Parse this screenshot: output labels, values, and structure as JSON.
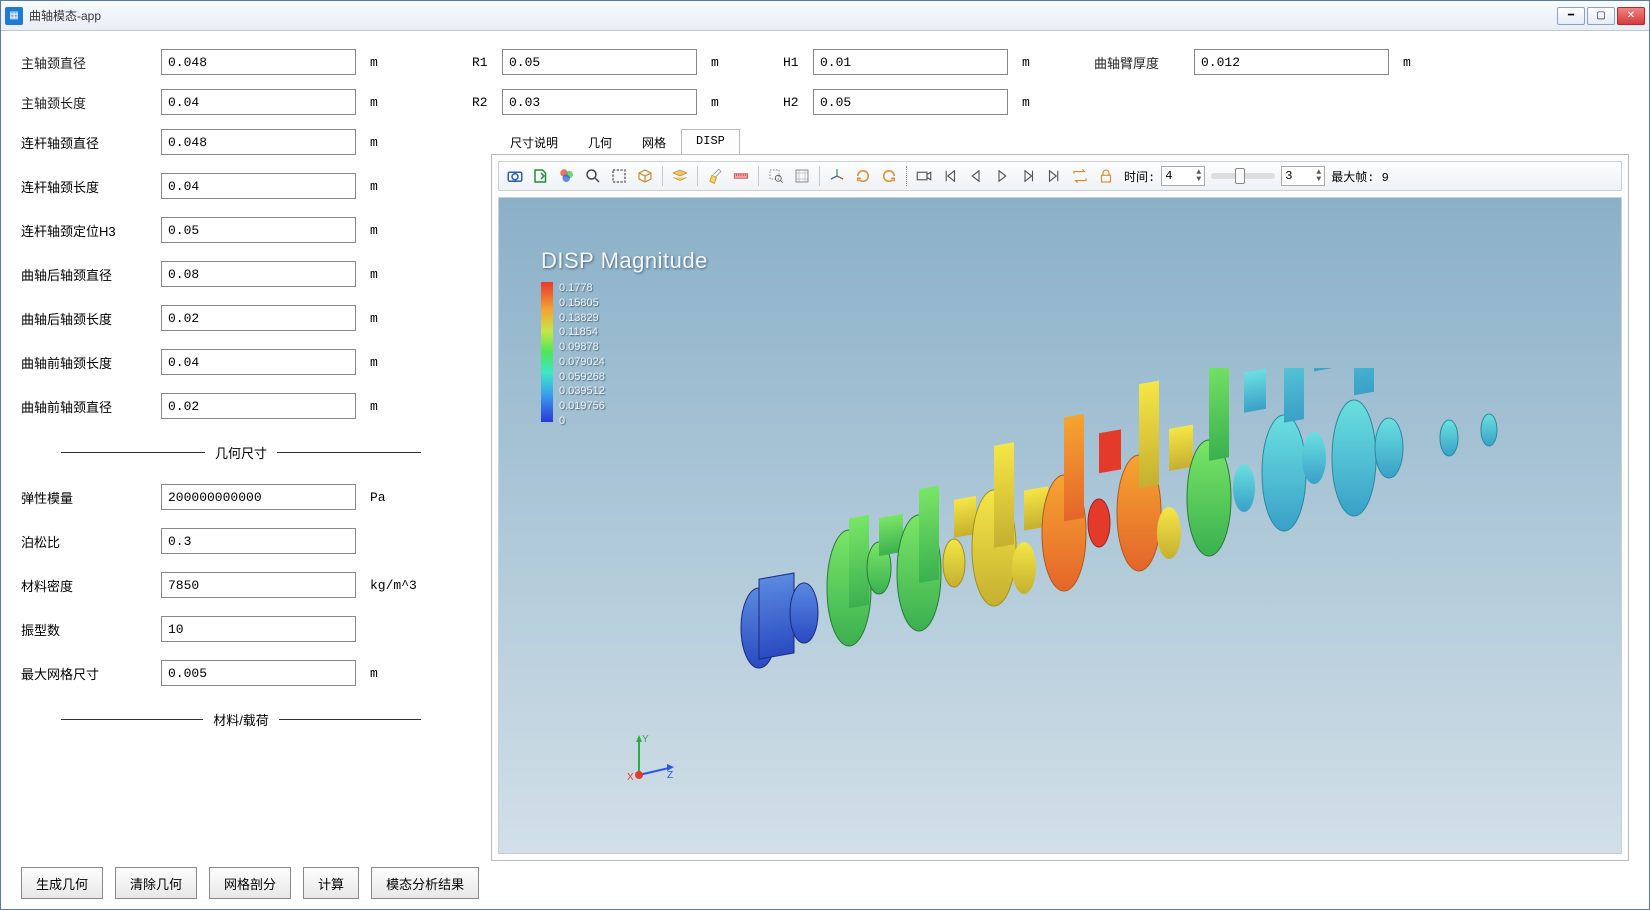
{
  "window": {
    "title": "曲轴模态-app"
  },
  "topParams": {
    "row1": {
      "c1": {
        "label": "主轴颈直径",
        "value": "0.048",
        "unit": "m"
      },
      "c2": {
        "label": "R1",
        "value": "0.05",
        "unit": "m"
      },
      "c3": {
        "label": "H1",
        "value": "0.01",
        "unit": "m"
      },
      "c4": {
        "label": "曲轴臂厚度",
        "value": "0.012",
        "unit": "m"
      }
    },
    "row2": {
      "c1": {
        "label": "主轴颈长度",
        "value": "0.04",
        "unit": "m"
      },
      "c2": {
        "label": "R2",
        "value": "0.03",
        "unit": "m"
      },
      "c3": {
        "label": "H2",
        "value": "0.05",
        "unit": "m"
      }
    }
  },
  "leftFields": [
    {
      "label": "连杆轴颈直径",
      "value": "0.048",
      "unit": "m"
    },
    {
      "label": "连杆轴颈长度",
      "value": "0.04",
      "unit": "m"
    },
    {
      "label": "连杆轴颈定位H3",
      "value": "0.05",
      "unit": "m"
    },
    {
      "label": "曲轴后轴颈直径",
      "value": "0.08",
      "unit": "m"
    },
    {
      "label": "曲轴后轴颈长度",
      "value": "0.02",
      "unit": "m"
    },
    {
      "label": "曲轴前轴颈长度",
      "value": "0.04",
      "unit": "m"
    },
    {
      "label": "曲轴前轴颈直径",
      "value": "0.02",
      "unit": "m"
    }
  ],
  "sep1": "几何尺寸",
  "materialFields": [
    {
      "label": "弹性模量",
      "value": "200000000000",
      "unit": "Pa"
    },
    {
      "label": "泊松比",
      "value": "0.3",
      "unit": ""
    },
    {
      "label": "材料密度",
      "value": "7850",
      "unit": "kg/m^3"
    },
    {
      "label": "振型数",
      "value": "10",
      "unit": ""
    },
    {
      "label": "最大网格尺寸",
      "value": "0.005",
      "unit": "m"
    }
  ],
  "sep2": "材料/载荷",
  "tabs": [
    "尺寸说明",
    "几何",
    "网格",
    "DISP"
  ],
  "activeTab": 3,
  "toolbar": {
    "time_label": "时间:",
    "time_value": "4",
    "frame_value": "3",
    "maxframe_label": "最大帧:",
    "maxframe_value": "9"
  },
  "legend": {
    "title": "DISP Magnitude",
    "values": [
      "0.1778",
      "0.15805",
      "0.13829",
      "0.11854",
      "0.09878",
      "0.079024",
      "0.059268",
      "0.039512",
      "0.019756",
      "0"
    ]
  },
  "buttons": [
    "生成几何",
    "清除几何",
    "网格剖分",
    "计算",
    "模态分析结果"
  ]
}
